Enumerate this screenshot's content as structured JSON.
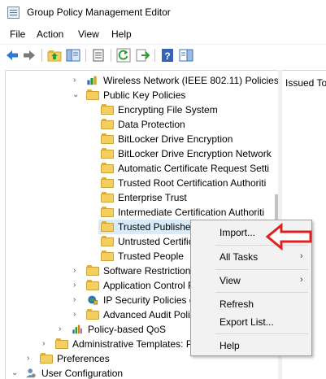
{
  "window": {
    "title": "Group Policy Management Editor"
  },
  "menubar": {
    "items": [
      "File",
      "Action",
      "View",
      "Help"
    ]
  },
  "toolbar": {
    "buttons": [
      "back-icon",
      "forward-icon",
      "up-folder-icon",
      "show-hide-tree-icon",
      "properties-icon",
      "refresh-icon",
      "export-list-icon",
      "help-icon",
      "show-pane-icon"
    ]
  },
  "tree": {
    "rows": [
      {
        "label": "Wireless Network (IEEE 802.11) Policies",
        "expander": "›",
        "icon": "wireless-network-icon"
      },
      {
        "label": "Public Key Policies",
        "expander": "⌄",
        "icon": "folder-icon"
      },
      {
        "label": "Encrypting File System",
        "expander": "",
        "icon": "folder-icon"
      },
      {
        "label": "Data Protection",
        "expander": "",
        "icon": "folder-icon"
      },
      {
        "label": "BitLocker Drive Encryption",
        "expander": "",
        "icon": "folder-icon"
      },
      {
        "label": "BitLocker Drive Encryption Network",
        "expander": "",
        "icon": "folder-icon"
      },
      {
        "label": "Automatic Certificate Request Setti",
        "expander": "",
        "icon": "folder-icon"
      },
      {
        "label": "Trusted Root Certification Authoriti",
        "expander": "",
        "icon": "folder-icon"
      },
      {
        "label": "Enterprise Trust",
        "expander": "",
        "icon": "folder-icon"
      },
      {
        "label": "Intermediate Certification Authoriti",
        "expander": "",
        "icon": "folder-icon"
      },
      {
        "label": "Trusted Publishers",
        "expander": "",
        "icon": "folder-icon",
        "selected": true
      },
      {
        "label": "Untrusted Certific",
        "expander": "",
        "icon": "folder-icon"
      },
      {
        "label": "Trusted People",
        "expander": "",
        "icon": "folder-icon"
      },
      {
        "label": "Software Restriction",
        "expander": "›",
        "icon": "folder-icon"
      },
      {
        "label": "Application Control P",
        "expander": "›",
        "icon": "folder-icon"
      },
      {
        "label": "IP Security Policies o",
        "expander": "›",
        "icon": "ip-security-icon"
      },
      {
        "label": "Advanced Audit Polic",
        "expander": "›",
        "icon": "folder-icon"
      },
      {
        "label": "Policy-based QoS",
        "expander": "›",
        "icon": "qos-chart-icon"
      },
      {
        "label": "Administrative Templates: P",
        "expander": "›",
        "icon": "folder-icon"
      },
      {
        "label": "Preferences",
        "expander": "›",
        "icon": "folder-icon"
      },
      {
        "label": "User Configuration",
        "expander": "⌄",
        "icon": "user-config-icon"
      }
    ]
  },
  "right_pane": {
    "column_header": "Issued To"
  },
  "context_menu": {
    "items": [
      {
        "label": "Import...",
        "submenu": false
      },
      {
        "label": "All Tasks",
        "submenu": true
      },
      {
        "label": "View",
        "submenu": true
      },
      {
        "label": "Refresh",
        "submenu": false
      },
      {
        "label": "Export List...",
        "submenu": false
      },
      {
        "label": "Help",
        "submenu": false
      }
    ]
  },
  "annotation": {
    "arrow_color": "#e02020",
    "points_to": "Import..."
  },
  "colors": {
    "selection": "#d9ebfb",
    "folder": "#f3cf62",
    "menu_bg": "#f2f2f2"
  }
}
